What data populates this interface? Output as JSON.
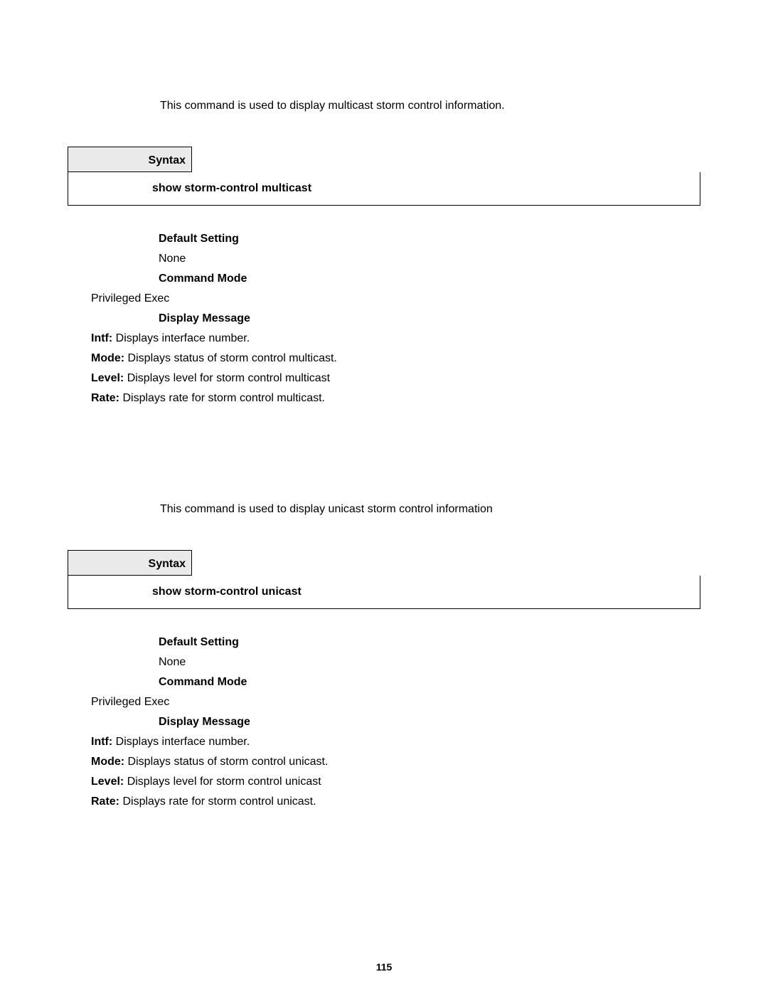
{
  "page_number": "115",
  "sections": [
    {
      "intro": "This command is used to display multicast storm control information.",
      "syntax_label": "Syntax",
      "syntax_command": "show storm-control multicast",
      "default_setting_label": "Default Setting",
      "default_setting_value": "None",
      "command_mode_label": "Command Mode",
      "command_mode_value": "Privileged Exec",
      "display_message_label": "Display Message",
      "messages": [
        {
          "term": "Intf:",
          "desc": " Displays interface number."
        },
        {
          "term": "Mode:",
          "desc": " Displays status of storm control multicast."
        },
        {
          "term": "Level:",
          "desc": " Displays level for storm control multicast"
        },
        {
          "term": "Rate:",
          "desc": " Displays rate for storm control multicast."
        }
      ]
    },
    {
      "intro": "This command is used to display unicast storm control information",
      "syntax_label": "Syntax",
      "syntax_command": "show storm-control unicast",
      "default_setting_label": "Default Setting",
      "default_setting_value": "None",
      "command_mode_label": "Command Mode",
      "command_mode_value": "Privileged Exec",
      "display_message_label": "Display Message",
      "messages": [
        {
          "term": "Intf:",
          "desc": " Displays interface number."
        },
        {
          "term": "Mode:",
          "desc": " Displays status of storm control unicast."
        },
        {
          "term": "Level:",
          "desc": " Displays level for storm control unicast"
        },
        {
          "term": "Rate:",
          "desc": " Displays rate for storm control unicast."
        }
      ]
    }
  ]
}
